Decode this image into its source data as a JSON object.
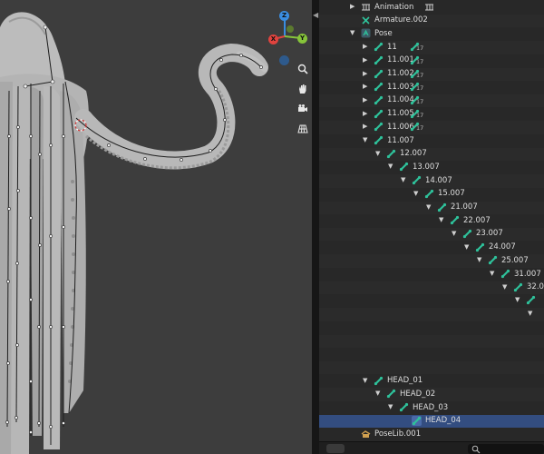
{
  "viewport": {
    "gizmo": {
      "z_label": "Z",
      "x_label": "X",
      "y_label": "Y"
    },
    "colors": {
      "background": "#3d3d3d",
      "mesh": "#bdbdbd",
      "bone": "#1e1e1e",
      "x_axis": "#e0433e",
      "y_axis": "#86c43a",
      "z_axis": "#3a8de0"
    },
    "nav_icons": [
      "zoom-icon",
      "hand-pan-icon",
      "camera-icon",
      "grid-perspective-icon"
    ]
  },
  "outliner": {
    "colors": {
      "bone_green": "#2ec19a",
      "selection": "#334d80",
      "text": "#dedede"
    },
    "rows": [
      {
        "label": "Animation",
        "indent": 0,
        "tri": "right",
        "icon": "action-icon"
      },
      {
        "label": "Armature.002",
        "indent": 0,
        "tri": "",
        "icon": "armature-data-icon"
      },
      {
        "label": "Pose",
        "indent": 0,
        "tri": "down",
        "icon": "pose-icon"
      },
      {
        "label": "11",
        "indent": 1,
        "tri": "right",
        "icon": "bone-icon",
        "count": "17"
      },
      {
        "label": "11.001",
        "indent": 1,
        "tri": "right",
        "icon": "bone-icon",
        "count": "17"
      },
      {
        "label": "11.002",
        "indent": 1,
        "tri": "right",
        "icon": "bone-icon",
        "count": "17"
      },
      {
        "label": "11.003",
        "indent": 1,
        "tri": "right",
        "icon": "bone-icon",
        "count": "17"
      },
      {
        "label": "11.004",
        "indent": 1,
        "tri": "right",
        "icon": "bone-icon",
        "count": "17"
      },
      {
        "label": "11.005",
        "indent": 1,
        "tri": "right",
        "icon": "bone-icon",
        "count": "17"
      },
      {
        "label": "11.006",
        "indent": 1,
        "tri": "right",
        "icon": "bone-icon",
        "count": "17"
      },
      {
        "label": "11.007",
        "indent": 1,
        "tri": "down",
        "icon": "bone-icon"
      },
      {
        "label": "12.007",
        "indent": 2,
        "tri": "down",
        "icon": "bone-icon"
      },
      {
        "label": "13.007",
        "indent": 3,
        "tri": "down",
        "icon": "bone-icon"
      },
      {
        "label": "14.007",
        "indent": 4,
        "tri": "down",
        "icon": "bone-icon"
      },
      {
        "label": "15.007",
        "indent": 5,
        "tri": "down",
        "icon": "bone-icon"
      },
      {
        "label": "21.007",
        "indent": 6,
        "tri": "down",
        "icon": "bone-icon"
      },
      {
        "label": "22.007",
        "indent": 7,
        "tri": "down",
        "icon": "bone-icon"
      },
      {
        "label": "23.007",
        "indent": 8,
        "tri": "down",
        "icon": "bone-icon"
      },
      {
        "label": "24.007",
        "indent": 9,
        "tri": "down",
        "icon": "bone-icon"
      },
      {
        "label": "25.007",
        "indent": 10,
        "tri": "down",
        "icon": "bone-icon"
      },
      {
        "label": "31.007",
        "indent": 11,
        "tri": "down",
        "icon": "bone-icon"
      },
      {
        "label": "32.0",
        "indent": 12,
        "tri": "down",
        "icon": "bone-icon"
      },
      {
        "label": "",
        "indent": 13,
        "tri": "down",
        "icon": "bone-icon"
      },
      {
        "label": "",
        "indent": 14,
        "tri": "down",
        "icon": ""
      },
      {
        "label": "",
        "indent": 0,
        "tri": "",
        "icon": ""
      },
      {
        "label": "",
        "indent": 0,
        "tri": "",
        "icon": ""
      },
      {
        "label": "",
        "indent": 0,
        "tri": "",
        "icon": ""
      },
      {
        "label": "",
        "indent": 0,
        "tri": "",
        "icon": ""
      },
      {
        "label": "HEAD_01",
        "indent": 1,
        "tri": "down",
        "icon": "bone-icon"
      },
      {
        "label": "HEAD_02",
        "indent": 2,
        "tri": "down",
        "icon": "bone-icon"
      },
      {
        "label": "HEAD_03",
        "indent": 3,
        "tri": "down",
        "icon": "bone-icon"
      },
      {
        "label": "HEAD_04",
        "indent": 4,
        "tri": "",
        "icon": "bone-icon",
        "selected": true
      },
      {
        "label": "PoseLib.001",
        "indent": 0,
        "tri": "",
        "icon": "poselib-icon"
      }
    ]
  }
}
